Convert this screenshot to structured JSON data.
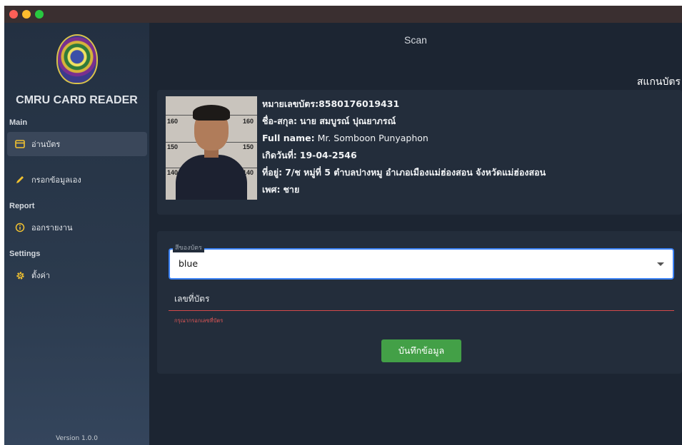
{
  "app": {
    "title": "CMRU CARD READER",
    "version": "Version 1.0.0"
  },
  "sidebar": {
    "sections": [
      {
        "label": "Main",
        "items": [
          {
            "label": "อ่านบัตร",
            "icon": "card-icon"
          },
          {
            "label": "กรอกข้อมูลเอง",
            "icon": "pencil-icon"
          }
        ]
      },
      {
        "label": "Report",
        "items": [
          {
            "label": "ออกรายงาน",
            "icon": "info-icon"
          }
        ]
      },
      {
        "label": "Settings",
        "items": [
          {
            "label": "ตั้งค่า",
            "icon": "gear-icon"
          }
        ]
      }
    ]
  },
  "header": {
    "title": "Scan",
    "section_heading": "สแกนบัตร"
  },
  "card": {
    "photo_numbers": [
      "160",
      "160",
      "150",
      "150",
      "140",
      "140"
    ],
    "fields": [
      {
        "label": "หมายเลขบัตร:",
        "value": "8580176019431"
      },
      {
        "label": "ชื่อ-สกุล:",
        "value": "นาย สมบูรณ์  ปุณยาภรณ์"
      },
      {
        "label": "Full name:",
        "value": "Mr. Somboon  Punyaphon"
      },
      {
        "label": "เกิดวันที่:",
        "value": "19-04-2546"
      },
      {
        "label": "ที่อยู่:",
        "value": "7/ช หมู่ที่ 5    ตำบลปางหมู อำเภอเมืองแม่ฮ่องสอน จังหวัดแม่ฮ่องสอน"
      },
      {
        "label": "เพศ:",
        "value": "ชาย"
      }
    ]
  },
  "form": {
    "color_select": {
      "label": "สีของบัตร",
      "value": "blue"
    },
    "card_number": {
      "label": "เลขที่บัตร",
      "value": "",
      "error": "กรุณากรอกเลขที่บัตร"
    },
    "save_label": "บันทึกข้อมูล"
  },
  "colors": {
    "accent": "#3b82f6",
    "save": "#43a047",
    "error": "#e05656",
    "background": "#1c2532",
    "panel": "#232d3b"
  }
}
